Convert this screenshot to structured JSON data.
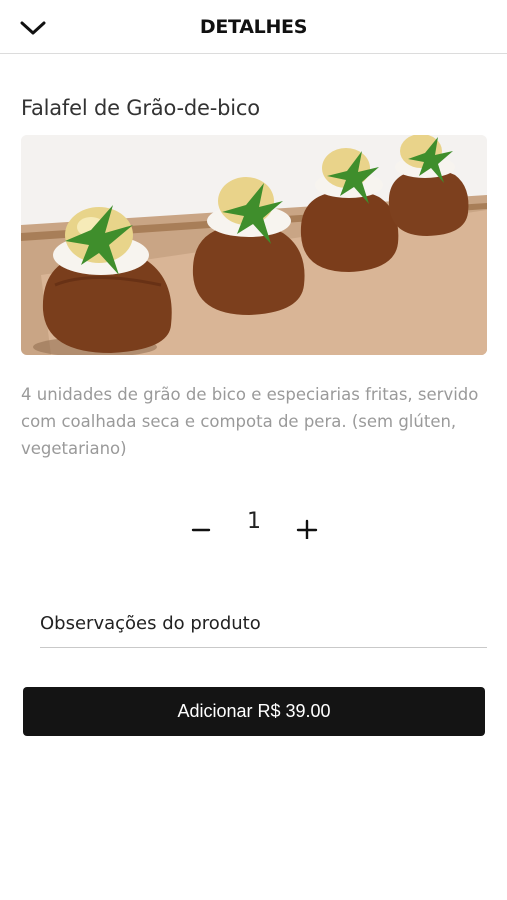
{
  "header": {
    "title": "DETALHES",
    "back_icon": "chevron-down-icon"
  },
  "product": {
    "name": "Falafel de Grão-de-bico",
    "description": "4 unidades de grão de bico e especiarias fritas, servido com coalhada seca e compota de pera. (sem glúten, vegetariano)",
    "image": "falafel-photo"
  },
  "quantity": {
    "value": "1",
    "minus_icon": "minus-icon",
    "plus_icon": "plus-icon"
  },
  "notes": {
    "placeholder": "Observações do produto",
    "value": ""
  },
  "add_button": {
    "label": "Adicionar R$ 39.00"
  },
  "colors": {
    "button_bg": "#141414",
    "button_text": "#ffffff",
    "description_text": "#9a9a9a",
    "divider": "#dcdcdc"
  }
}
